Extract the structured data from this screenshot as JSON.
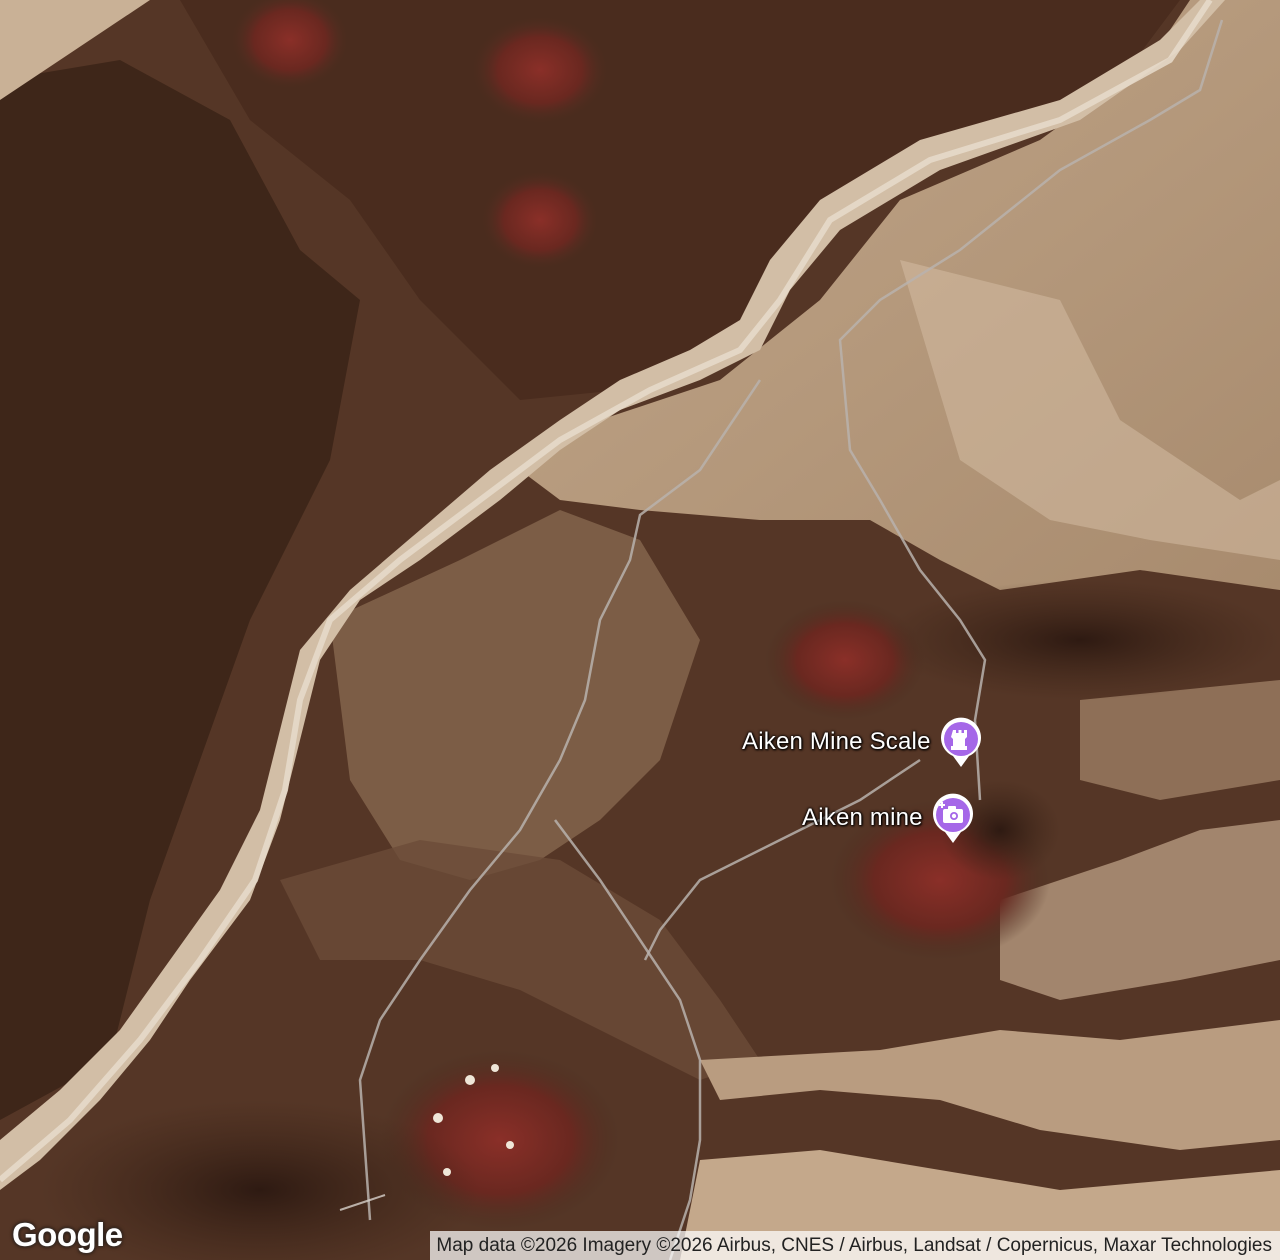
{
  "map": {
    "type": "satellite",
    "colors": {
      "dark_terrain": "#4a2e20",
      "red_cinder": "#7a2a22",
      "wash_light": "#c9b196",
      "plain_tan": "#b59a7e",
      "road": "#b8b2ad"
    }
  },
  "pois": [
    {
      "label": "Aiken Mine Scale",
      "icon": "castle-icon",
      "color": "#a567e8"
    },
    {
      "label": "Aiken mine",
      "icon": "camera-plus-icon",
      "color": "#a567e8"
    }
  ],
  "branding": {
    "logo": "Google"
  },
  "attribution": "Map data ©2026 Imagery ©2026 Airbus, CNES / Airbus, Landsat / Copernicus, Maxar Technologies"
}
